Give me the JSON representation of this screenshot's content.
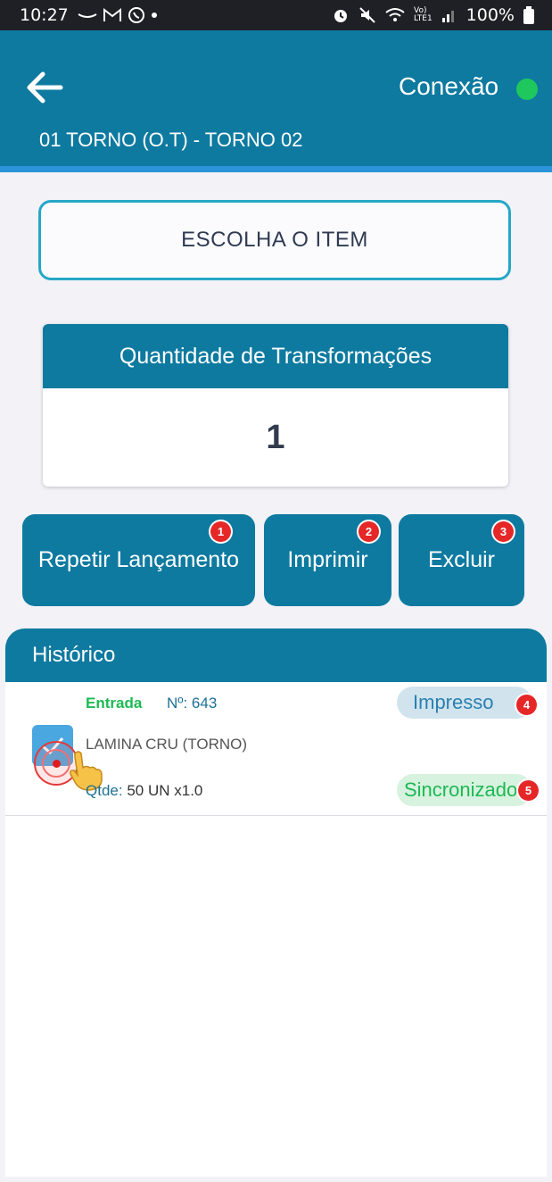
{
  "status_bar": {
    "time": "10:27",
    "battery": "100%",
    "network_label_top": "Vo)",
    "network_label_bottom": "LTE1"
  },
  "header": {
    "connection_label": "Conexão",
    "connection_color": "#1ec85c",
    "machine_title": "01 TORNO (O.T) - TORNO 02"
  },
  "choose_item": {
    "label": "ESCOLHA O ITEM"
  },
  "quantity": {
    "title": "Quantidade de Transformações",
    "value": "1"
  },
  "actions": [
    {
      "label": "Repetir Lançamento",
      "badge": "1"
    },
    {
      "label": "Imprimir",
      "badge": "2"
    },
    {
      "label": "Excluir",
      "badge": "3"
    }
  ],
  "history": {
    "title": "Histórico",
    "items": [
      {
        "type_label": "Entrada",
        "number_label": "Nº: 643",
        "name": "LAMINA CRU (TORNO)",
        "qty_label": "Qtde:",
        "qty_value": "50 UN x1.0",
        "print_status": "Impresso",
        "print_badge": "4",
        "sync_status": "Sincronizado",
        "sync_badge": "5"
      }
    ]
  },
  "colors": {
    "primary": "#0e7aa0",
    "accent_stripe": "#2b93d9",
    "success": "#1db954",
    "badge": "#e62727"
  }
}
